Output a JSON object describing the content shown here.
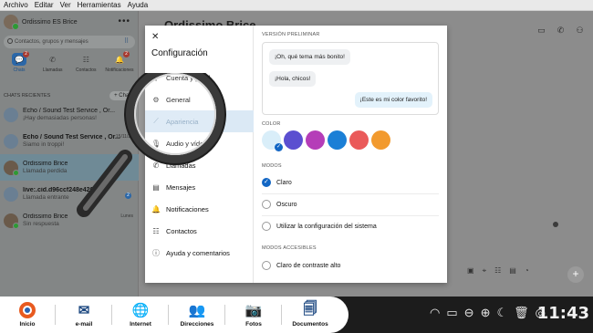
{
  "menubar": [
    "Archivo",
    "Editar",
    "Ver",
    "Herramientas",
    "Ayuda"
  ],
  "sidebar": {
    "profile_name": "Ordissimo ES Brice",
    "search_placeholder": "Contactos, grupos y mensajes",
    "tabs": [
      {
        "label": "Chats",
        "badge": "2",
        "icon": "chat-icon"
      },
      {
        "label": "Llamadas",
        "badge": "",
        "icon": "phone-icon"
      },
      {
        "label": "Contactos",
        "badge": "",
        "icon": "contacts-icon"
      },
      {
        "label": "Notificaciones",
        "badge": "2",
        "icon": "bell-icon"
      }
    ],
    "recents_label": "CHATS RECIENTES",
    "chat_button": "+ Chat",
    "chats": [
      {
        "name": "Echo / Sound Test Service , Or...",
        "sub": "¡Hay demasiadas personas!",
        "time": "",
        "badge": "",
        "bold": false
      },
      {
        "name": "Echo / Sound Test Service , Or...",
        "sub": "Siamo in troppi!",
        "time": "15/11/21",
        "badge": "",
        "bold": true
      },
      {
        "name": "Ordissimo Brice",
        "sub": "Llamada perdida",
        "time": "",
        "badge": "",
        "bold": false
      },
      {
        "name": "live:.cid.d96ccf248e426fe",
        "sub": "Llamada entrante",
        "time": "",
        "badge": "2",
        "bold": true
      },
      {
        "name": "Ordissimo Brice",
        "sub": "Sin respuesta",
        "time": "Lunes",
        "badge": "",
        "bold": false
      }
    ]
  },
  "main": {
    "title": "Ordissimo Brice"
  },
  "dialog": {
    "title": "Configuración",
    "menu": [
      {
        "label": "Cuenta y perfil",
        "icon": "account-icon"
      },
      {
        "label": "General",
        "icon": "gear-icon"
      },
      {
        "label": "Apariencia",
        "icon": "wand-icon"
      },
      {
        "label": "Audio y vídeo",
        "icon": "mic-icon"
      },
      {
        "label": "Llamadas",
        "icon": "phone-icon"
      },
      {
        "label": "Mensajes",
        "icon": "message-icon"
      },
      {
        "label": "Notificaciones",
        "icon": "bell-icon"
      },
      {
        "label": "Contactos",
        "icon": "contacts-icon"
      },
      {
        "label": "Ayuda y comentarios",
        "icon": "info-icon"
      }
    ],
    "preview_label": "VERSIÓN PRELIMINAR",
    "bubbles": {
      "first": "¡Oh, qué tema más bonito!",
      "second": "¡Hola, chicos!",
      "mine": "¡Este es mi color favorito!"
    },
    "color_label": "COLOR",
    "colors": [
      "#d9eef9",
      "#5b4fd0",
      "#b53db8",
      "#1b7fd6",
      "#ea5a5a",
      "#f29a2e"
    ],
    "modes_label": "MODOS",
    "modes": [
      {
        "label": "Claro",
        "selected": true
      },
      {
        "label": "Oscuro",
        "selected": false
      },
      {
        "label": "Utilizar la configuración del sistema",
        "selected": false
      }
    ],
    "accessible_label": "MODOS ACCESIBLES",
    "accessible": [
      {
        "label": "Claro de contraste alto",
        "selected": false
      }
    ]
  },
  "taskbar": {
    "items": [
      {
        "label": "Inicio",
        "icon": "ordissimo-logo-icon"
      },
      {
        "label": "e-mail",
        "icon": "envelope-icon"
      },
      {
        "label": "Internet",
        "icon": "globe-icon"
      },
      {
        "label": "Direcciones",
        "icon": "address-book-icon"
      },
      {
        "label": "Fotos",
        "icon": "camera-icon"
      },
      {
        "label": "Documentos",
        "icon": "documents-icon"
      }
    ],
    "clock": "11:43"
  }
}
